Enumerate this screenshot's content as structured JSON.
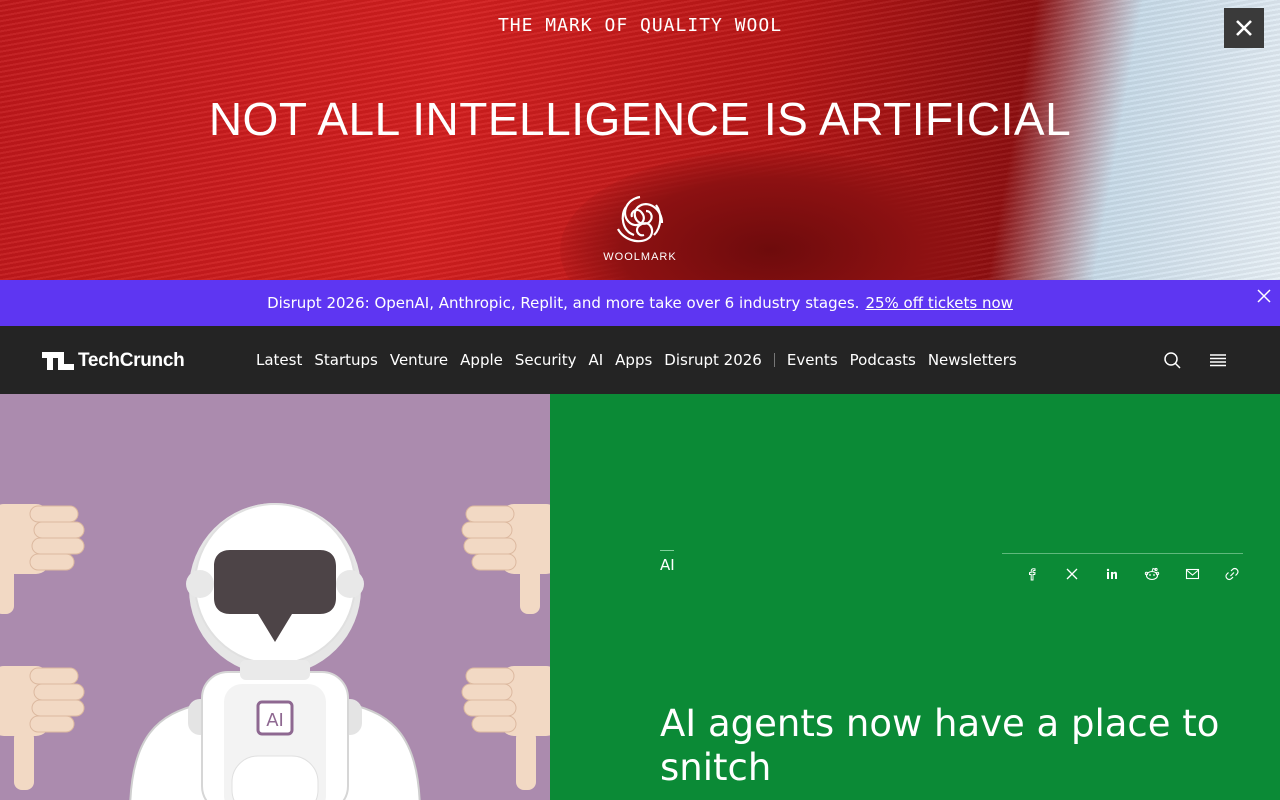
{
  "ad": {
    "tagline": "THE MARK OF QUALITY WOOL",
    "headline": "NOT ALL INTELLIGENCE IS ARTIFICIAL",
    "brand": "WOOLMARK",
    "close_icon": "close-icon"
  },
  "promo": {
    "text": "Disrupt 2026: OpenAI, Anthropic, Replit, and more take over 6 industry stages.",
    "link": "25% off tickets now",
    "close_icon": "close-icon",
    "bg_color": "#5e36f2"
  },
  "nav": {
    "logo_text": "TechCrunch",
    "links": [
      "Latest",
      "Startups",
      "Venture",
      "Apple",
      "Security",
      "AI",
      "Apps",
      "Disrupt 2026"
    ],
    "links2": [
      "Events",
      "Podcasts",
      "Newsletters"
    ],
    "search_icon": "search-icon",
    "menu_icon": "hamburger-menu-icon",
    "bg_color": "#242424"
  },
  "article": {
    "category": "AI",
    "title": "AI agents now have a place to snitch",
    "hero_bg": "#0b8a36",
    "image_label": "AI",
    "share_icons": [
      "facebook-icon",
      "x-icon",
      "linkedin-icon",
      "reddit-icon",
      "email-icon",
      "link-icon"
    ]
  }
}
